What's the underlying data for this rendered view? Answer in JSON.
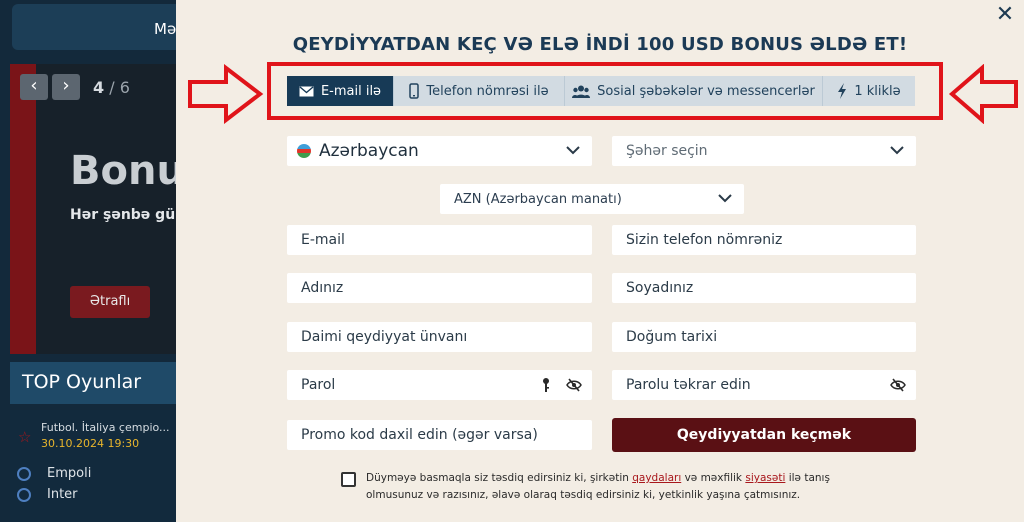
{
  "background": {
    "topbar_label": "Mə",
    "slider": {
      "prev": "‹",
      "next": "›",
      "current": "4",
      "separator": " / ",
      "total": "6"
    },
    "banner": {
      "title": "Bonus",
      "subtitle": "Hər şənbə gü",
      "more_button": "Ətraflı"
    },
    "top_games": {
      "header": "TOP Oyunlar",
      "match": {
        "title": "Futbol. İtaliya çempio...",
        "time": "30.10.2024 19:30",
        "team1": "Empoli",
        "team2": "Inter"
      }
    }
  },
  "modal": {
    "close_label": "✕",
    "title": "QEYDİYYATDAN KEÇ VƏ ELƏ İNDİ 100 USD BONUS ƏLDƏ ET!",
    "tabs": [
      {
        "label": "E-mail ilə",
        "icon": "envelope-icon",
        "active": true
      },
      {
        "label": "Telefon nömrəsi ilə",
        "icon": "phone-icon",
        "active": false
      },
      {
        "label": "Sosial şəbəkələr və messencerlər",
        "icon": "users-icon",
        "active": false
      },
      {
        "label": "1 kliklə",
        "icon": "lightning-icon",
        "active": false
      }
    ],
    "country": "Azərbaycan",
    "city_placeholder": "Şəhər seçin",
    "currency": "AZN (Azərbaycan manatı)",
    "fields": {
      "email": "E-mail",
      "phone": "Sizin telefon nömrəniz",
      "first_name": "Adınız",
      "last_name": "Soyadınız",
      "address": "Daimi qeydiyyat ünvanı",
      "birth_date": "Doğum tarixi",
      "password": "Parol",
      "password_repeat": "Parolu təkrar edin",
      "promo": "Promo kod daxil edin (əgər varsa)"
    },
    "submit_label": "Qeydiyyatdan keçmək",
    "terms": {
      "part1": "Düyməyə basmaqla siz təsdiq edirsiniz ki, şirkətin ",
      "link_rules": "qaydaları",
      "part2": " və məxfilik ",
      "link_policy": "siyasəti",
      "part3": " ilə tanış olmusunuz və razısınız, əlavə olaraq təsdiq edirsiniz ki, yetkinlik yaşına çatmısınız."
    }
  },
  "colors": {
    "accent": "#173a56",
    "submit": "#5a1014",
    "highlight": "#e0141a",
    "panel": "#f3ede4"
  }
}
